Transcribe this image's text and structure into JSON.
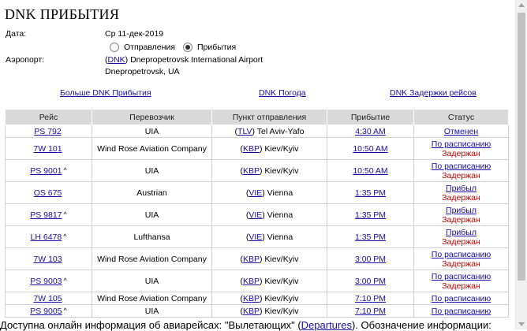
{
  "page": {
    "title": "DNK ПРИБЫТИЯ",
    "date_label": "Дата:",
    "date_value": "Ср 11-дек-2019",
    "radio_departures": "Отправления",
    "radio_arrivals": "Прибытия",
    "airport_label": "Аэропорт:",
    "airport_code": "DNK",
    "airport_name": " Dnepropetrovsk International Airport",
    "airport_city": "Dnepropetrovsk, UA"
  },
  "links": {
    "more_arrivals": "Больше DNK Прибытия",
    "weather": "DNK Погода",
    "delays": "DNK Задержки рейсов"
  },
  "table": {
    "headers": [
      "Рейс",
      "Перевозчик",
      "Пункт отправления",
      "Прибытие",
      "Статус"
    ],
    "rows": [
      {
        "flight": "PS 792",
        "caret": "",
        "carrier": "UIA",
        "code": "TLV",
        "city": " Tel Aviv-Yafo",
        "time": "4:30 AM",
        "status1": "Отменен",
        "status2": ""
      },
      {
        "flight": "7W 101",
        "caret": "",
        "carrier": "Wind Rose Aviation Company",
        "code": "KBP",
        "city": " Kiev/Kyiv",
        "time": "10:50 AM",
        "status1": "По расписанию",
        "status2": "Задержан"
      },
      {
        "flight": "PS 9001",
        "caret": "^",
        "carrier": "UIA",
        "code": "KBP",
        "city": " Kiev/Kyiv",
        "time": "10:50 AM",
        "status1": "По расписанию",
        "status2": "Задержан"
      },
      {
        "flight": "OS 675",
        "caret": "",
        "carrier": "Austrian",
        "code": "VIE",
        "city": " Vienna",
        "time": "1:35 PM",
        "status1": "Прибыл",
        "status2": "Задержан"
      },
      {
        "flight": "PS 9817",
        "caret": "^",
        "carrier": "UIA",
        "code": "VIE",
        "city": " Vienna",
        "time": "1:35 PM",
        "status1": "Прибыл",
        "status2": "Задержан"
      },
      {
        "flight": "LH 6478",
        "caret": "^",
        "carrier": "Lufthansa",
        "code": "VIE",
        "city": " Vienna",
        "time": "1:35 PM",
        "status1": "Прибыл",
        "status2": "Задержан"
      },
      {
        "flight": "7W 103",
        "caret": "",
        "carrier": "Wind Rose Aviation Company",
        "code": "KBP",
        "city": " Kiev/Kyiv",
        "time": "3:00 PM",
        "status1": "По расписанию",
        "status2": "Задержан"
      },
      {
        "flight": "PS 9003",
        "caret": "^",
        "carrier": "UIA",
        "code": "KBP",
        "city": " Kiev/Kyiv",
        "time": "3:00 PM",
        "status1": "По расписанию",
        "status2": "Задержан"
      },
      {
        "flight": "7W 105",
        "caret": "",
        "carrier": "Wind Rose Aviation Company",
        "code": "KBP",
        "city": " Kiev/Kyiv",
        "time": "7:10 PM",
        "status1": "По расписанию",
        "status2": ""
      },
      {
        "flight": "PS 9005",
        "caret": "^",
        "carrier": "UIA",
        "code": "KBP",
        "city": " Kiev/Kyiv",
        "time": "7:10 PM",
        "status1": "По расписанию",
        "status2": ""
      }
    ]
  },
  "footer": {
    "text_before": "Доступна онлайн информация об авиарейсах: \"Вылетающих\" (",
    "departures_link": "Departures",
    "text_after": "). Обозначение информации:"
  },
  "colors": {
    "link": "#1a0dab",
    "delayed": "#cc0000",
    "header_bg": "#d9d9d9"
  }
}
